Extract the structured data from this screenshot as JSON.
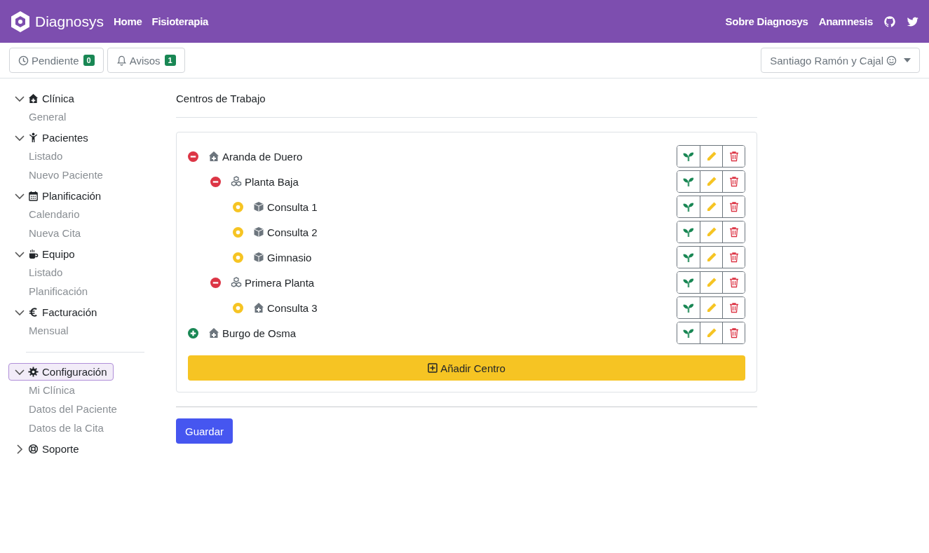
{
  "navbar": {
    "brand": "Diagnosys",
    "links": [
      "Home",
      "Fisioterapia"
    ],
    "right_links": [
      "Sobre Diagnosys",
      "Anamnesis"
    ]
  },
  "toolbar": {
    "buttons": [
      {
        "kind": "clock",
        "label": "Pendiente",
        "badge": "0"
      },
      {
        "kind": "bell",
        "label": "Avisos",
        "badge": "1"
      }
    ],
    "user": "Santiago Ramón y Cajal"
  },
  "sidebar": {
    "groups": [
      {
        "kind": "house",
        "label": "Clínica",
        "expanded": true,
        "selected": false,
        "items": [
          "General"
        ]
      },
      {
        "kind": "person",
        "label": "Pacientes",
        "expanded": true,
        "selected": false,
        "items": [
          "Listado",
          "Nuevo Paciente"
        ]
      },
      {
        "kind": "calendar",
        "label": "Planificación",
        "expanded": true,
        "selected": false,
        "items": [
          "Calendario",
          "Nueva Cita"
        ]
      },
      {
        "kind": "mug",
        "label": "Equipo",
        "expanded": true,
        "selected": false,
        "items": [
          "Listado",
          "Planificación"
        ]
      },
      {
        "kind": "euro",
        "label": "Facturación",
        "expanded": true,
        "selected": false,
        "items": [
          "Mensual"
        ]
      },
      {
        "kind": "gear",
        "label": "Configuración",
        "expanded": true,
        "selected": true,
        "divider_before": true,
        "items": [
          "Mi Clínica",
          "Datos del Paciente",
          "Datos de la Cita"
        ]
      },
      {
        "kind": "lifebuoy",
        "label": "Soporte",
        "expanded": false,
        "selected": false
      }
    ]
  },
  "main": {
    "title": "Centros de Trabajo",
    "tree": [
      {
        "kind": "house",
        "label": "Aranda de Duero",
        "expanded": true,
        "children": [
          {
            "kind": "cubes",
            "label": "Planta Baja",
            "expanded": true,
            "children": [
              {
                "kind": "cube",
                "label": "Consulta 1"
              },
              {
                "kind": "cube",
                "label": "Consulta 2"
              },
              {
                "kind": "cube",
                "label": "Gimnasio"
              }
            ]
          },
          {
            "kind": "cubes",
            "label": "Primera Planta",
            "expanded": true,
            "children": [
              {
                "kind": "house",
                "label": "Consulta 3"
              }
            ]
          }
        ]
      },
      {
        "kind": "house",
        "label": "Burgo de Osma",
        "expanded": false
      }
    ],
    "add_button": "Añadir Centro",
    "save_button": "Guardar"
  }
}
